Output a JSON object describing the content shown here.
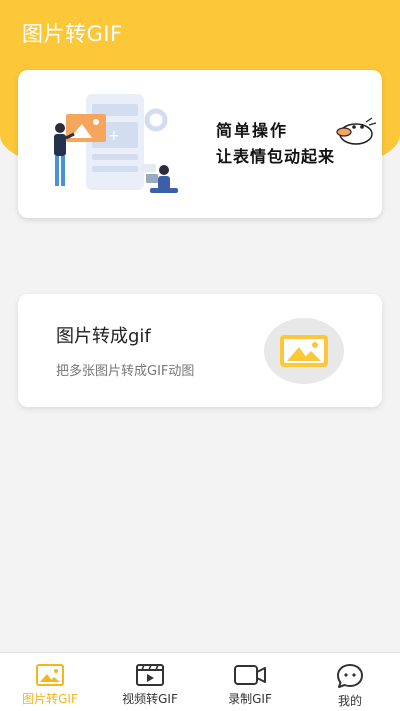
{
  "header": {
    "title": "图片转GIF",
    "accent": "#fdc73a"
  },
  "banner": {
    "slogan_line1": "简单操作",
    "slogan_line2": "让表情包动起来"
  },
  "feature": {
    "title": "图片转成gif",
    "subtitle": "把多张图片转成GIF动图",
    "icon": "image-icon"
  },
  "tabbar": {
    "active_color": "#f5b51d",
    "items": [
      {
        "label": "图片转GIF",
        "icon": "image-icon",
        "active": true
      },
      {
        "label": "视频转GIF",
        "icon": "video-icon",
        "active": false
      },
      {
        "label": "录制GIF",
        "icon": "record-icon",
        "active": false
      },
      {
        "label": "我的",
        "icon": "profile-icon",
        "active": false
      }
    ]
  }
}
